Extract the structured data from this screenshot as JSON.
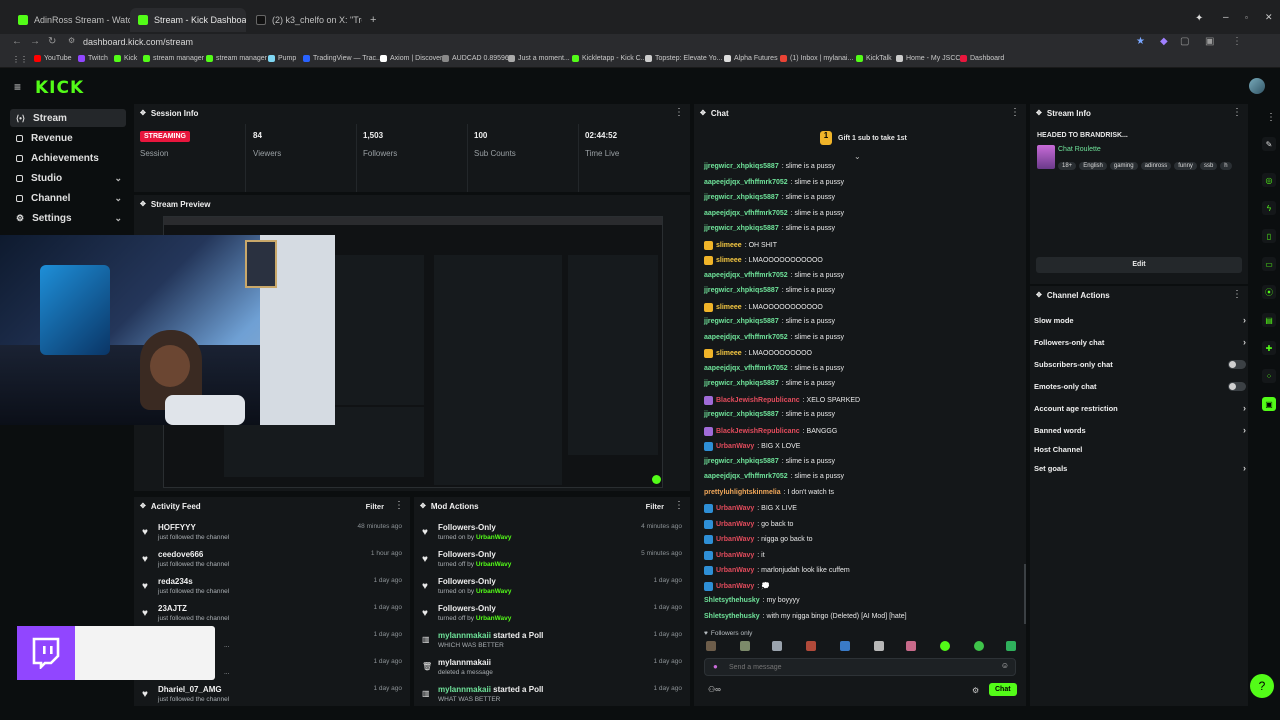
{
  "browser": {
    "tabs": [
      {
        "title": "AdinRoss Stream - Watch Li..."
      },
      {
        "title": "Stream - Kick Dashboard"
      },
      {
        "title": "(2) k3_chelfo on X: \"Treyliving ..."
      }
    ],
    "new_tab": "+",
    "url": "dashboard.kick.com/stream",
    "bookmarks": [
      "YouTube",
      "Twitch",
      "Kick",
      "stream manager",
      "stream manager",
      "Pump",
      "TradingView — Trac...",
      "Axiom | Discover",
      "AUDCAD 0.89596",
      "Just a moment...",
      "Kickletapp - Kick C...",
      "Topstep: Elevate Yo...",
      "Alpha Futures",
      "(1) Inbox | mylanai...",
      "KickTalk",
      "Home - My JSCC",
      "Dashboard"
    ]
  },
  "app": {
    "logo": "KICK"
  },
  "sidebar": {
    "items": [
      {
        "label": "Stream",
        "icon": "stream-icon"
      },
      {
        "label": "Revenue",
        "icon": "revenue-icon"
      },
      {
        "label": "Achievements",
        "icon": "achievements-icon"
      },
      {
        "label": "Studio",
        "icon": "studio-icon"
      },
      {
        "label": "Channel",
        "icon": "channel-icon"
      },
      {
        "label": "Settings",
        "icon": "settings-icon"
      }
    ]
  },
  "session": {
    "title": "Session Info",
    "status": "STREAMING",
    "status_label": "Session",
    "stats": [
      {
        "value": "84",
        "label": "Viewers"
      },
      {
        "value": "1,503",
        "label": "Followers"
      },
      {
        "value": "100",
        "label": "Sub Counts"
      },
      {
        "value": "02:44:52",
        "label": "Time Live"
      }
    ]
  },
  "preview": {
    "title": "Stream Preview"
  },
  "activity": {
    "title": "Activity Feed",
    "filter": "Filter",
    "rows": [
      {
        "name": "HOFFYYY",
        "sub": "just followed the channel",
        "time": "48 minutes ago"
      },
      {
        "name": "ceedove666",
        "sub": "just followed the channel",
        "time": "1 hour ago"
      },
      {
        "name": "reda234s",
        "sub": "just followed the channel",
        "time": "1 day ago"
      },
      {
        "name": "23AJTZ",
        "sub": "just followed the channel",
        "time": "1 day ago"
      },
      {
        "name": "",
        "sub": "...",
        "time": "1 day ago"
      },
      {
        "name": "",
        "sub": "...",
        "time": "1 day ago"
      },
      {
        "name": "Dhariel_07_AMG",
        "sub": "just followed the channel",
        "time": "1 day ago"
      }
    ]
  },
  "mod": {
    "title": "Mod Actions",
    "filter": "Filter",
    "rows": [
      {
        "name": "Followers-Only",
        "sub_prefix": "turned on by",
        "by": "UrbanWavy",
        "time": "4 minutes ago"
      },
      {
        "name": "Followers-Only",
        "sub_prefix": "turned off by",
        "by": "UrbanWavy",
        "time": "5 minutes ago"
      },
      {
        "name": "Followers-Only",
        "sub_prefix": "turned on by",
        "by": "UrbanWavy",
        "time": "1 day ago"
      },
      {
        "name": "Followers-Only",
        "sub_prefix": "turned off by",
        "by": "UrbanWavy",
        "time": "1 day ago"
      },
      {
        "name": "mylannmakaii",
        "name_suffix": "started a Poll",
        "sub_prefix": "WHICH WAS BETTER",
        "by": "",
        "time": "1 day ago"
      },
      {
        "name": "mylannmakaii",
        "name_suffix": "",
        "sub_prefix": "deleted a message",
        "by": "",
        "time": "1 day ago"
      },
      {
        "name": "mylannmakaii",
        "name_suffix": "started a Poll",
        "sub_prefix": "WHAT WAS BETTER",
        "by": "",
        "time": "1 day ago"
      }
    ]
  },
  "chat": {
    "title": "Chat",
    "gift_banner": "Gift 1 sub to take 1st",
    "messages": [
      {
        "user": "jjregwicr_xhpkiqs5887",
        "text": ": slime is a pussy",
        "color": "green",
        "badge": ""
      },
      {
        "user": "aapeejdjqx_vfhffmrk7052",
        "text": ": slime is a pussy",
        "color": "green",
        "badge": ""
      },
      {
        "user": "jjregwicr_xhpkiqs5887",
        "text": ": slime is a pussy",
        "color": "green",
        "badge": ""
      },
      {
        "user": "aapeejdjqx_vfhffmrk7052",
        "text": ": slime is a pussy",
        "color": "green",
        "badge": ""
      },
      {
        "user": "jjregwicr_xhpkiqs5887",
        "text": ": slime is a pussy",
        "color": "green",
        "badge": ""
      },
      {
        "user": "slimeee",
        "text": ": OH SHIT",
        "color": "gold",
        "badge": "gold"
      },
      {
        "user": "slimeee",
        "text": ": LMAOOOOOOOOOOO",
        "color": "gold",
        "badge": "gold"
      },
      {
        "user": "aapeejdjqx_vfhffmrk7052",
        "text": ": slime is a pussy",
        "color": "green",
        "badge": ""
      },
      {
        "user": "jjregwicr_xhpkiqs5887",
        "text": ": slime is a pussy",
        "color": "green",
        "badge": ""
      },
      {
        "user": "slimeee",
        "text": ": LMAOOOOOOOOOOO",
        "color": "gold",
        "badge": "gold"
      },
      {
        "user": "jjregwicr_xhpkiqs5887",
        "text": ": slime is a pussy",
        "color": "green",
        "badge": ""
      },
      {
        "user": "aapeejdjqx_vfhffmrk7052",
        "text": ": slime is a pussy",
        "color": "green",
        "badge": ""
      },
      {
        "user": "slimeee",
        "text": ": LMAOOOOOOOOO",
        "color": "gold",
        "badge": "gold"
      },
      {
        "user": "aapeejdjqx_vfhffmrk7052",
        "text": ": slime is a pussy",
        "color": "green",
        "badge": ""
      },
      {
        "user": "jjregwicr_xhpkiqs5887",
        "text": ": slime is a pussy",
        "color": "green",
        "badge": ""
      },
      {
        "user": "BlackJewishRepublicanc",
        "text": ": XELO SPARKED",
        "color": "red",
        "badge": "pink"
      },
      {
        "user": "jjregwicr_xhpkiqs5887",
        "text": ": slime is a pussy",
        "color": "green",
        "badge": ""
      },
      {
        "user": "BlackJewishRepublicanc",
        "text": ": BANGGG",
        "color": "red",
        "badge": "pink"
      },
      {
        "user": "UrbanWavy",
        "text": ": BIG X LOVE",
        "color": "red",
        "badge": "blue"
      },
      {
        "user": "jjregwicr_xhpkiqs5887",
        "text": ": slime is a pussy",
        "color": "green",
        "badge": ""
      },
      {
        "user": "aapeejdjqx_vfhffmrk7052",
        "text": ": slime is a pussy",
        "color": "green",
        "badge": ""
      },
      {
        "user": "prettyluhlightskinmelia",
        "text": ": I don't watch ts",
        "color": "orange",
        "badge": ""
      },
      {
        "user": "UrbanWavy",
        "text": ": BIG X LIVE",
        "color": "red",
        "badge": "blue"
      },
      {
        "user": "UrbanWavy",
        "text": ": go back to",
        "color": "red",
        "badge": "blue"
      },
      {
        "user": "UrbanWavy",
        "text": ": nigga go back to",
        "color": "red",
        "badge": "blue"
      },
      {
        "user": "UrbanWavy",
        "text": ": it",
        "color": "red",
        "badge": "blue"
      },
      {
        "user": "UrbanWavy",
        "text": ": marlonjudah look like cuffem",
        "color": "red",
        "badge": "blue"
      },
      {
        "user": "UrbanWavy",
        "text": ": 💭",
        "color": "red",
        "badge": "blue"
      },
      {
        "user": "Shletsythehusky",
        "text": ": my boyyyy",
        "color": "green",
        "badge": ""
      },
      {
        "user": "Shletsythehusky",
        "text": ": with my nigga bingo (Deleted) [AI Mod] [hate]",
        "color": "green",
        "badge": ""
      }
    ],
    "followers_only": "Followers only",
    "input_placeholder": "Send a message",
    "send_label": "Chat"
  },
  "stream_info": {
    "title": "Stream Info",
    "stream_title": "HEADED TO BRANDRISK...",
    "category": "Chat Roulette",
    "tags": [
      "18+",
      "English",
      "gaming",
      "adinross",
      "funny",
      "ssb",
      "h"
    ],
    "edit_label": "Edit"
  },
  "channel_actions": {
    "title": "Channel Actions",
    "rows": [
      {
        "label": "Slow mode",
        "control": "chevron"
      },
      {
        "label": "Followers-only chat",
        "control": "chevron"
      },
      {
        "label": "Subscribers-only chat",
        "control": "toggle"
      },
      {
        "label": "Emotes-only chat",
        "control": "toggle"
      },
      {
        "label": "Account age restriction",
        "control": "chevron"
      },
      {
        "label": "Banned words",
        "control": "chevron"
      },
      {
        "label": "Host Channel",
        "control": "none"
      },
      {
        "label": "Set goals",
        "control": "chevron"
      }
    ]
  },
  "colors": {
    "accent": "#53fc18",
    "streaming": "#e8163d",
    "panel": "#141719",
    "background": "#0b0e0f"
  }
}
